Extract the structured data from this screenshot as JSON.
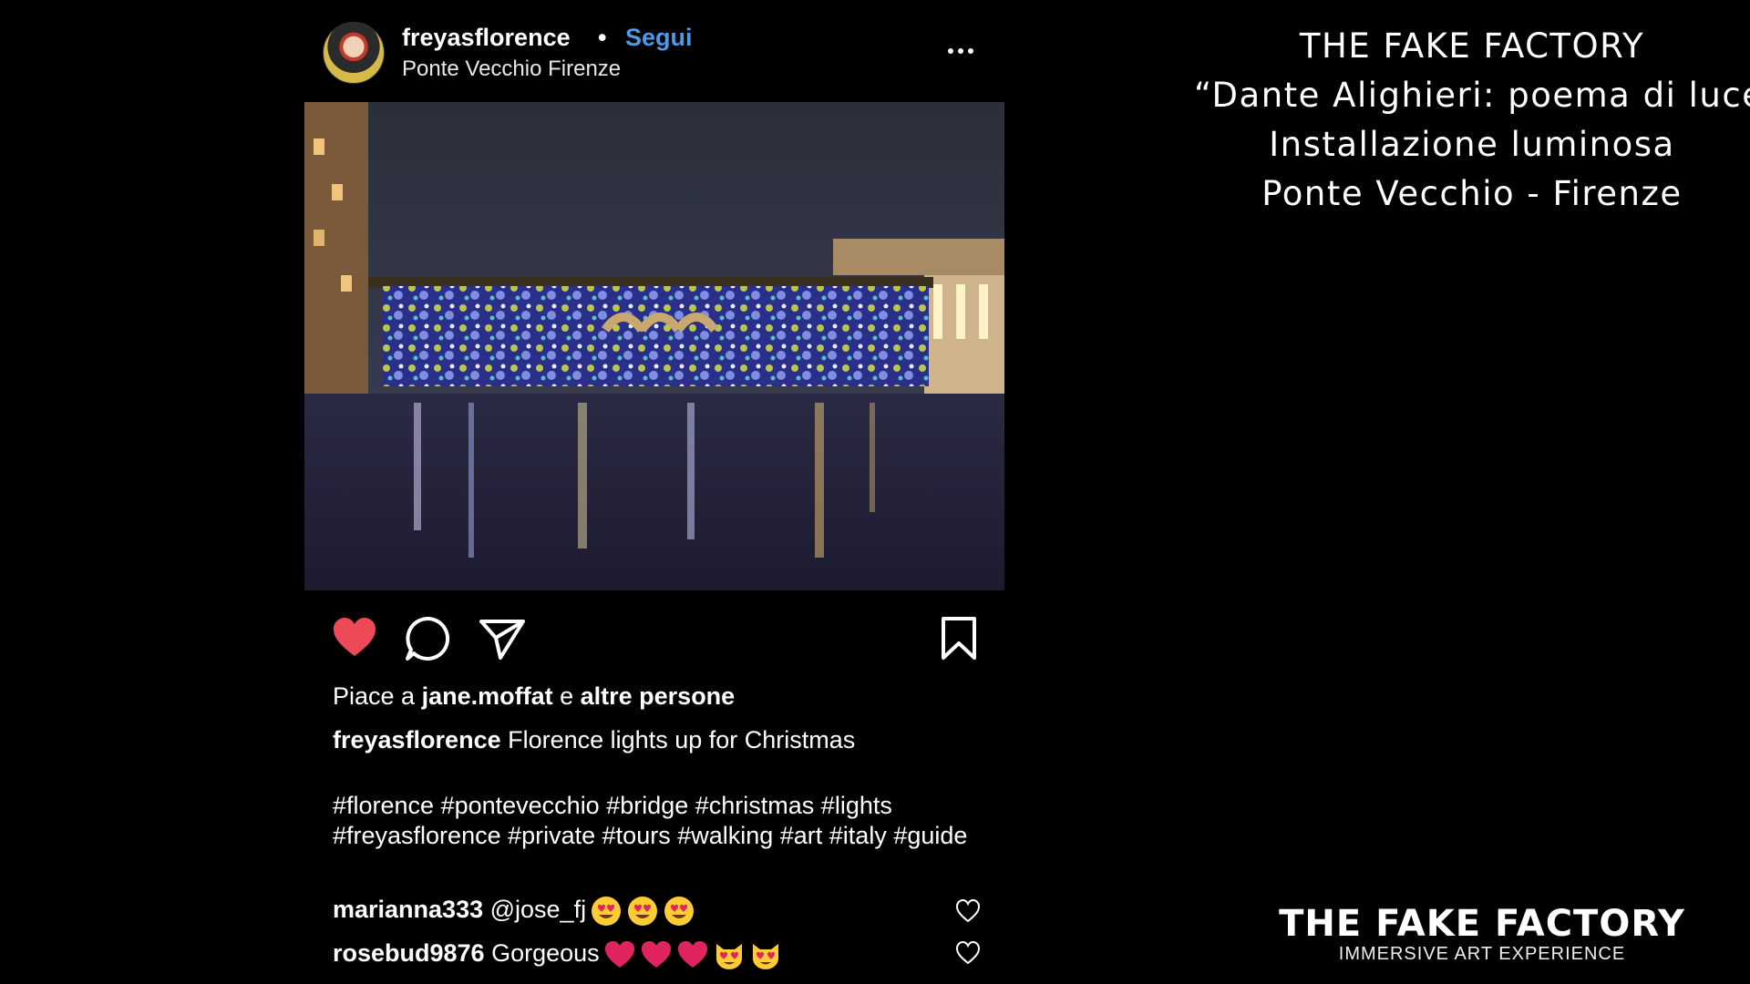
{
  "post": {
    "username": "freyasflorence",
    "separator": "•",
    "follow_label": "Segui",
    "location": "Ponte Vecchio Firenze",
    "likes": {
      "prefix": "Piace a ",
      "user": "jane.moffat",
      "middle": " e ",
      "others": "altre persone"
    },
    "caption": {
      "user": "freyasflorence",
      "text": " Florence lights up for Christmas"
    },
    "hashtags": "#florence #pontevecchio #bridge #christmas #lights #freyasflorence #private #tours #walking #art #italy #guide",
    "comments": [
      {
        "user": "marianna333",
        "text": " @jose_fj",
        "emojis": [
          "heart-eyes",
          "heart-eyes",
          "heart-eyes"
        ]
      },
      {
        "user": "rosebud9876",
        "text": " Gorgeous",
        "emojis": [
          "red-heart",
          "red-heart",
          "red-heart",
          "heart-eyes-cat",
          "heart-eyes-cat"
        ]
      }
    ],
    "icons": {
      "like": "heart-filled-icon",
      "comment": "comment-icon",
      "share": "send-icon",
      "save": "bookmark-icon",
      "more": "more-icon"
    },
    "colors": {
      "like": "#ed4956",
      "follow": "#4c9ae8"
    }
  },
  "title_lines": [
    "THE FAKE FACTORY",
    "“Dante Alighieri: poema di luce”",
    "Installazione luminosa",
    "Ponte Vecchio - Firenze"
  ],
  "brand": {
    "name": "THE FAKE FACTORY",
    "tagline": "IMMERSIVE ART EXPERIENCE"
  }
}
